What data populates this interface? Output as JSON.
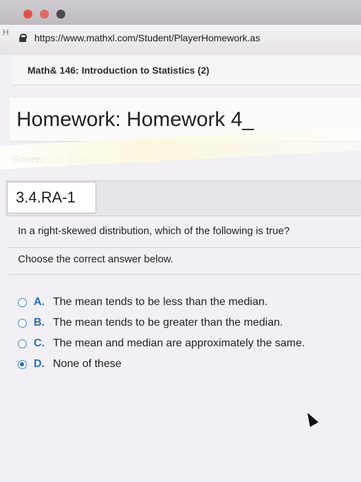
{
  "browser": {
    "tab_label": "H",
    "url": "https://www.mathxl.com/Student/PlayerHomework.as"
  },
  "page": {
    "course_title": "Math& 146: Introduction to Statistics (2)",
    "homework_title": "Homework: Homework 4_",
    "score_label": "Score:",
    "score_value": "0 of 1 pt",
    "question_id": "3.4.RA-1",
    "question_text": "In a right-skewed distribution, which of the following is true?",
    "instruction": "Choose the correct answer below.",
    "options": [
      {
        "letter": "A.",
        "text": "The mean tends to be less than the median.",
        "selected": false
      },
      {
        "letter": "B.",
        "text": "The mean tends to be greater than the median.",
        "selected": false
      },
      {
        "letter": "C.",
        "text": "The mean and median are approximately the same.",
        "selected": false
      },
      {
        "letter": "D.",
        "text": "None of these",
        "selected": true
      }
    ]
  },
  "colors": {
    "accent": "#2a6db0",
    "radio_border": "#3a86c6"
  }
}
